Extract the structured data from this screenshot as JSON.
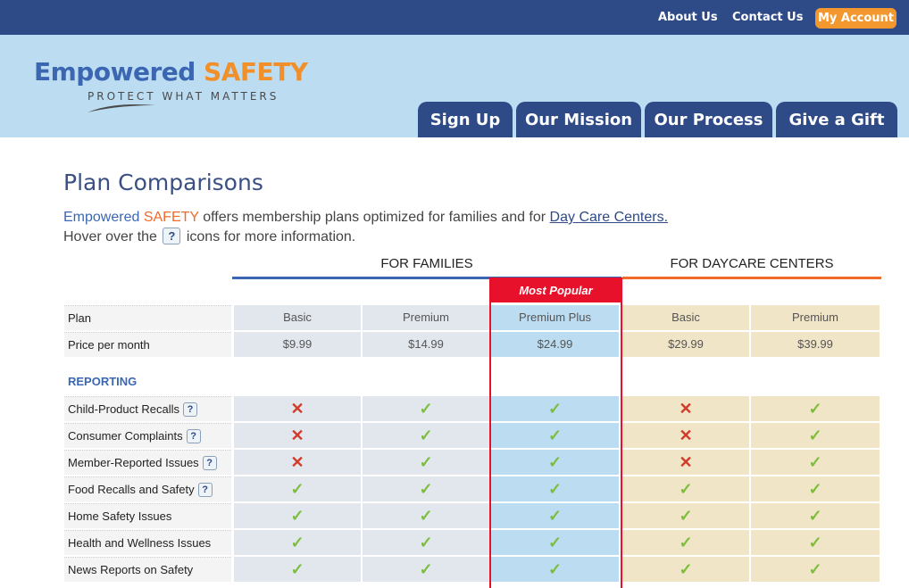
{
  "topnav": {
    "about": "About Us",
    "contact": "Contact Us",
    "account": "My Account"
  },
  "logo": {
    "part1": "Empowered",
    "part2": "SAFETY",
    "tagline": "PROTECT WHAT MATTERS"
  },
  "tabs": [
    "Sign Up",
    "Our Mission",
    "Our Process",
    "Give a Gift"
  ],
  "page": {
    "title": "Plan Comparisons",
    "intro_brand1": "Empowered",
    "intro_brand2": "SAFETY",
    "intro_text": " offers membership plans optimized for families and for ",
    "intro_link": "Day Care Centers.",
    "hover_pre": "Hover over the",
    "hover_icon": "?",
    "hover_post": "icons for more information."
  },
  "groups": {
    "families": "FOR FAMILIES",
    "daycare": "FOR DAYCARE CENTERS"
  },
  "most_popular": "Most Popular",
  "table": {
    "plan_label": "Plan",
    "price_label": "Price per month",
    "plans": [
      "Basic",
      "Premium",
      "Premium Plus",
      "Basic",
      "Premium"
    ],
    "prices": [
      "$9.99",
      "$14.99",
      "$24.99",
      "$29.99",
      "$39.99"
    ],
    "section": "REPORTING",
    "features": [
      {
        "name": "Child-Product Recalls",
        "help": "?",
        "values": [
          false,
          true,
          true,
          false,
          true
        ]
      },
      {
        "name": "Consumer Complaints",
        "help": "?",
        "values": [
          false,
          true,
          true,
          false,
          true
        ]
      },
      {
        "name": "Member-Reported Issues",
        "help": "?",
        "values": [
          false,
          true,
          true,
          false,
          true
        ]
      },
      {
        "name": "Food Recalls and Safety",
        "help": "?",
        "values": [
          true,
          true,
          true,
          true,
          true
        ]
      },
      {
        "name": "Home Safety Issues",
        "values": [
          true,
          true,
          true,
          true,
          true
        ]
      },
      {
        "name": "Health and Wellness Issues",
        "values": [
          true,
          true,
          true,
          true,
          true
        ]
      },
      {
        "name": "News Reports on Safety",
        "values": [
          true,
          true,
          true,
          true,
          true
        ]
      }
    ]
  },
  "colors": {
    "navy": "#2e4a87",
    "orange": "#f3982f",
    "header": "#bcdcf2",
    "red": "#e8112c",
    "check": "#7cbe3c",
    "cross": "#d23a2a"
  }
}
